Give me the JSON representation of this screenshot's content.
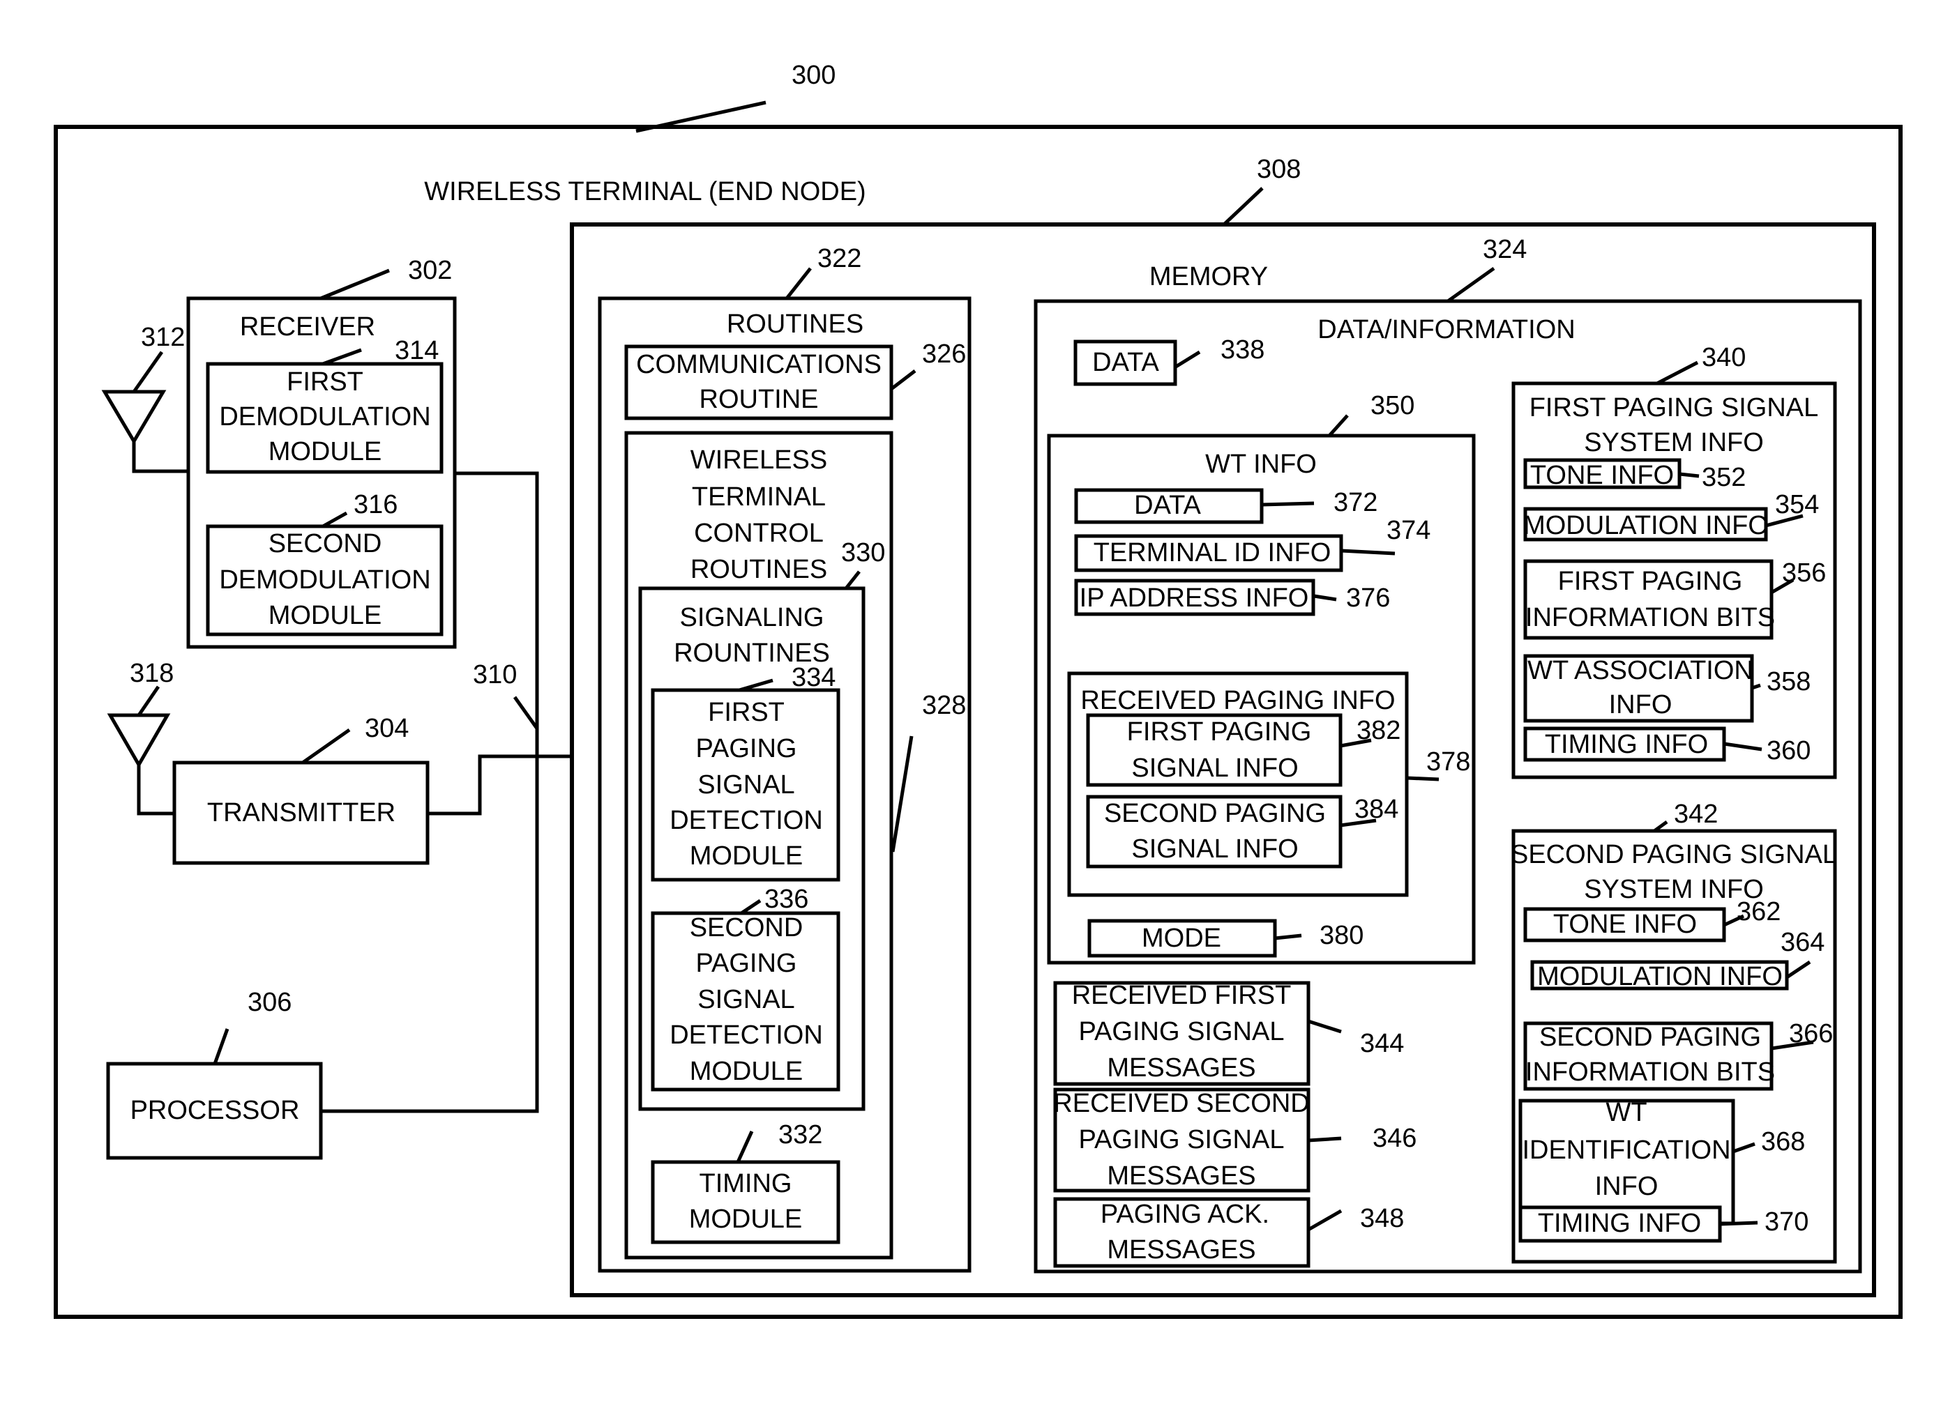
{
  "figure": {
    "ref": "300",
    "title": "WIRELESS TERMINAL (END NODE)"
  },
  "antennas": [
    {
      "id": "rx-antenna",
      "ref": "312"
    },
    {
      "id": "tx-antenna",
      "ref": "318"
    }
  ],
  "bus": {
    "ref": "310"
  },
  "receiver": {
    "ref": "302",
    "label": "RECEIVER",
    "modules": [
      {
        "ref": "314",
        "lines": [
          "FIRST",
          "DEMODULATION",
          "MODULE"
        ]
      },
      {
        "ref": "316",
        "lines": [
          "SECOND",
          "DEMODULATION",
          "MODULE"
        ]
      }
    ]
  },
  "transmitter": {
    "ref": "304",
    "label": "TRANSMITTER"
  },
  "processor": {
    "ref": "306",
    "label": "PROCESSOR"
  },
  "memory": {
    "ref": "308",
    "label": "MEMORY",
    "routines": {
      "ref": "322",
      "label": "ROUTINES",
      "communications_routine": {
        "ref": "326",
        "lines": [
          "COMMUNICATIONS",
          "ROUTINE"
        ]
      },
      "wt_control_routines": {
        "ref": "328",
        "lines": [
          "WIRELESS",
          "TERMINAL",
          "CONTROL",
          "ROUTINES"
        ],
        "signaling_routines": {
          "ref": "330",
          "lines": [
            "SIGNALING",
            "ROUNTINES"
          ],
          "modules": [
            {
              "ref": "334",
              "lines": [
                "FIRST",
                "PAGING",
                "SIGNAL",
                "DETECTION",
                "MODULE"
              ]
            },
            {
              "ref": "336",
              "lines": [
                "SECOND",
                "PAGING",
                "SIGNAL",
                "DETECTION",
                "MODULE"
              ]
            }
          ]
        },
        "timing_module": {
          "ref": "332",
          "lines": [
            "TIMING",
            "MODULE"
          ]
        }
      }
    },
    "data_information": {
      "ref": "324",
      "label": "DATA/INFORMATION",
      "data": {
        "ref": "338",
        "label": "DATA"
      },
      "wt_info": {
        "ref": "350",
        "label": "WT INFO",
        "items": [
          {
            "ref": "372",
            "label": "DATA"
          },
          {
            "ref": "374",
            "label": "TERMINAL ID INFO"
          },
          {
            "ref": "376",
            "label": "IP ADDRESS INFO"
          }
        ],
        "received_paging_info": {
          "ref": "378",
          "label": "RECEIVED PAGING INFO",
          "items": [
            {
              "ref": "382",
              "lines": [
                "FIRST PAGING",
                "SIGNAL INFO"
              ]
            },
            {
              "ref": "384",
              "lines": [
                "SECOND PAGING",
                "SIGNAL INFO"
              ]
            }
          ]
        },
        "mode": {
          "ref": "380",
          "label": "MODE"
        }
      },
      "messages": [
        {
          "ref": "344",
          "lines": [
            "RECEIVED FIRST",
            "PAGING SIGNAL",
            "MESSAGES"
          ]
        },
        {
          "ref": "346",
          "lines": [
            "RECEIVED SECOND",
            "PAGING SIGNAL",
            "MESSAGES"
          ]
        },
        {
          "ref": "348",
          "lines": [
            "PAGING ACK.",
            "MESSAGES"
          ]
        }
      ],
      "first_paging_system_info": {
        "ref": "340",
        "lines": [
          "FIRST PAGING SIGNAL",
          "SYSTEM INFO"
        ],
        "items": [
          {
            "ref": "352",
            "lines": [
              "TONE INFO"
            ]
          },
          {
            "ref": "354",
            "lines": [
              "MODULATION INFO"
            ]
          },
          {
            "ref": "356",
            "lines": [
              "FIRST PAGING",
              "INFORMATION BITS"
            ]
          },
          {
            "ref": "358",
            "lines": [
              "WT ASSOCIATION",
              "INFO"
            ]
          },
          {
            "ref": "360",
            "lines": [
              "TIMING INFO"
            ]
          }
        ]
      },
      "second_paging_system_info": {
        "ref": "342",
        "lines": [
          "SECOND PAGING SIGNAL",
          "SYSTEM INFO"
        ],
        "items": [
          {
            "ref": "362",
            "lines": [
              "TONE INFO"
            ]
          },
          {
            "ref": "364",
            "lines": [
              "MODULATION INFO"
            ]
          },
          {
            "ref": "366",
            "lines": [
              "SECOND PAGING",
              "INFORMATION BITS"
            ]
          },
          {
            "ref": "368",
            "lines": [
              "WT",
              "IDENTIFICATION",
              "INFO"
            ]
          },
          {
            "ref": "370",
            "lines": [
              "TIMING INFO"
            ]
          }
        ]
      }
    }
  }
}
